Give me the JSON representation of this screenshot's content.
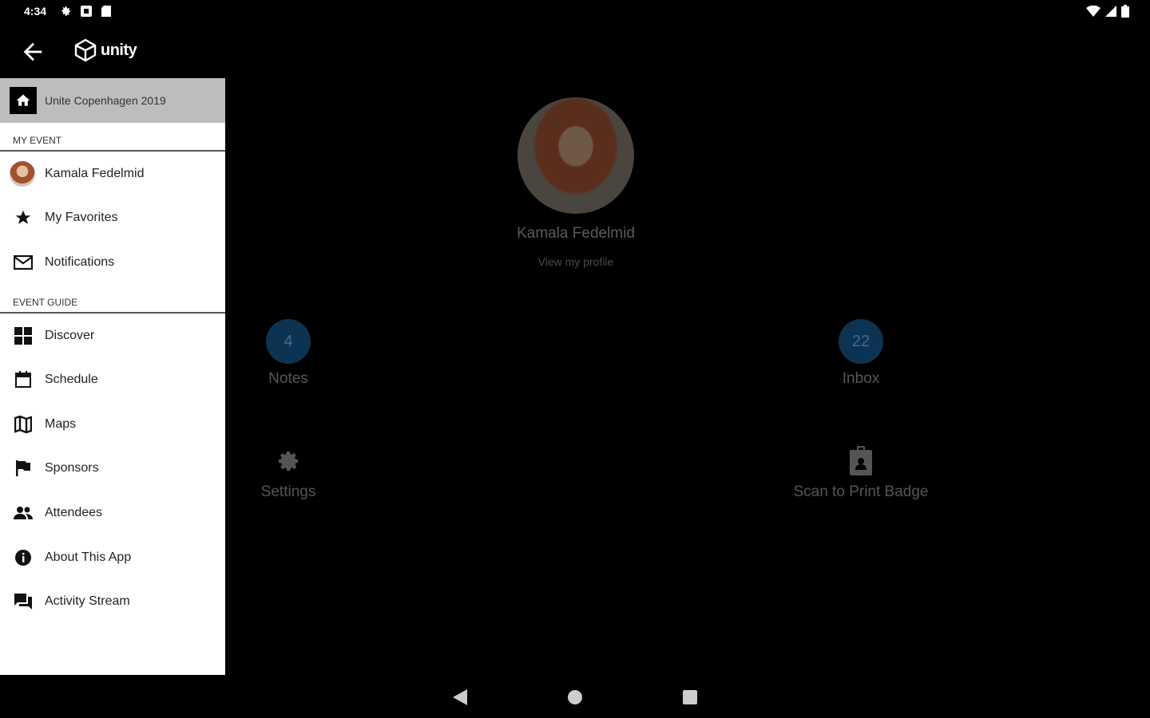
{
  "status": {
    "time": "4:34"
  },
  "app": {
    "logo_text": "unity"
  },
  "drawer": {
    "event": "Unite Copenhagen 2019",
    "section_my_event": "MY EVENT",
    "my_event_items": [
      {
        "label": "Kamala Fedelmid",
        "icon": "avatar"
      },
      {
        "label": "My Favorites",
        "icon": "star-icon"
      },
      {
        "label": "Notifications",
        "icon": "mail-icon"
      }
    ],
    "section_event_guide": "EVENT GUIDE",
    "guide_items": [
      {
        "label": "Discover",
        "icon": "grid-icon"
      },
      {
        "label": "Schedule",
        "icon": "calendar-icon"
      },
      {
        "label": "Maps",
        "icon": "map-icon"
      },
      {
        "label": "Sponsors",
        "icon": "flag-icon"
      },
      {
        "label": "Attendees",
        "icon": "people-icon"
      },
      {
        "label": "About This App",
        "icon": "info-icon"
      },
      {
        "label": "Activity Stream",
        "icon": "forum-icon"
      }
    ]
  },
  "profile": {
    "name": "Kamala Fedelmid",
    "link": "View my profile"
  },
  "tiles": {
    "notes": {
      "count": "4",
      "label": "Notes"
    },
    "inbox": {
      "count": "22",
      "label": "Inbox"
    },
    "settings": {
      "label": "Settings"
    },
    "badge": {
      "label": "Scan to Print Badge"
    }
  },
  "colors": {
    "badge_bg": "#0d3352",
    "drawer_bg": "#ffffff",
    "event_row_bg": "#bdbdbd"
  }
}
